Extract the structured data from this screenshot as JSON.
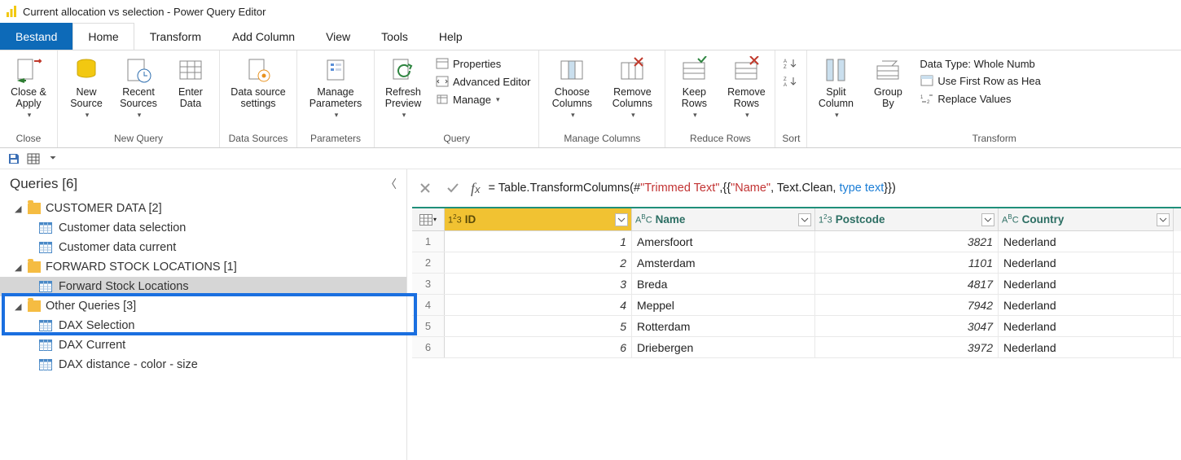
{
  "app": {
    "title": "Current allocation vs selection - Power Query Editor"
  },
  "menu": {
    "tabs": [
      "Bestand",
      "Home",
      "Transform",
      "Add Column",
      "View",
      "Tools",
      "Help"
    ],
    "active_primary": 0,
    "active_secondary": 1
  },
  "ribbon": {
    "close": {
      "label": "Close",
      "btn_close_apply": "Close &\nApply"
    },
    "newquery": {
      "label": "New Query",
      "btn_new_source": "New\nSource",
      "btn_recent": "Recent\nSources",
      "btn_enter": "Enter\nData"
    },
    "datasrc": {
      "label": "Data Sources",
      "btn": "Data source\nsettings"
    },
    "params": {
      "label": "Parameters",
      "btn": "Manage\nParameters"
    },
    "query": {
      "label": "Query",
      "btn_refresh": "Refresh\nPreview",
      "r_props": "Properties",
      "r_adv": "Advanced Editor",
      "r_manage": "Manage"
    },
    "mcols": {
      "label": "Manage Columns",
      "btn_choose": "Choose\nColumns",
      "btn_remove": "Remove\nColumns"
    },
    "rrows": {
      "label": "Reduce Rows",
      "btn_keep": "Keep\nRows",
      "btn_remove": "Remove\nRows"
    },
    "sort": {
      "label": "Sort"
    },
    "transform": {
      "label": "Transform",
      "btn_split": "Split\nColumn",
      "btn_group": "Group\nBy",
      "r_dtype": "Data Type: Whole Numb",
      "r_first": "Use First Row as Hea",
      "r_repl": "Replace Values"
    }
  },
  "sidebar": {
    "header": "Queries [6]",
    "groups": [
      {
        "name": "CUSTOMER DATA [2]",
        "items": [
          "Customer data selection",
          "Customer data current"
        ]
      },
      {
        "name": "FORWARD STOCK LOCATIONS [1]",
        "items": [
          "Forward Stock Locations"
        ],
        "selected_index": 0
      },
      {
        "name": "Other Queries [3]",
        "items": [
          "DAX Selection",
          "DAX Current",
          "DAX distance - color - size"
        ]
      }
    ]
  },
  "formula": {
    "prefix": "= Table.TransformColumns(#",
    "str1": "\"Trimmed Text\"",
    "mid": ",{{",
    "str2": "\"Name\"",
    "mid2": ", Text.Clean, ",
    "kw": "type text",
    "suffix": "}})"
  },
  "grid": {
    "columns": [
      {
        "name": "ID",
        "type": "123"
      },
      {
        "name": "Name",
        "type": "ABC"
      },
      {
        "name": "Postcode",
        "type": "123"
      },
      {
        "name": "Country",
        "type": "ABC"
      }
    ],
    "rows": [
      {
        "n": "1",
        "ID": "1",
        "Name": "Amersfoort",
        "Postcode": "3821",
        "Country": "Nederland"
      },
      {
        "n": "2",
        "ID": "2",
        "Name": "Amsterdam",
        "Postcode": "1101",
        "Country": "Nederland"
      },
      {
        "n": "3",
        "ID": "3",
        "Name": "Breda",
        "Postcode": "4817",
        "Country": "Nederland"
      },
      {
        "n": "4",
        "ID": "4",
        "Name": "Meppel",
        "Postcode": "7942",
        "Country": "Nederland"
      },
      {
        "n": "5",
        "ID": "5",
        "Name": "Rotterdam",
        "Postcode": "3047",
        "Country": "Nederland"
      },
      {
        "n": "6",
        "ID": "6",
        "Name": "Driebergen",
        "Postcode": "3972",
        "Country": "Nederland"
      }
    ]
  }
}
